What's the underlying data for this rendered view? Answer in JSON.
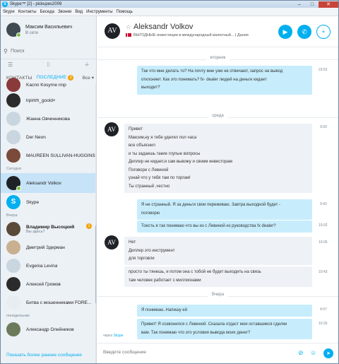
{
  "window": {
    "title": "Skype™ [2] - pickupes2009"
  },
  "menu": [
    "Skype",
    "Контакты",
    "Беседа",
    "Звонки",
    "Вид",
    "Инструменты",
    "Помощь"
  ],
  "me": {
    "name": "Максим Васильевич",
    "status": "В сети"
  },
  "search": {
    "placeholder": "Поиск"
  },
  "tabs": {
    "contacts": "КОНТАКТЫ",
    "recent": "ПОСЛЕДНИЕ",
    "recent_badge": "2",
    "filter": "Все"
  },
  "contacts": [
    {
      "name": "Kacnn Kosyrne nnp",
      "color": "#8b3a3a"
    },
    {
      "name": "lrpirtrh_goold+",
      "color": "#2b2b2b"
    },
    {
      "name": "Жанна Овчинникова",
      "color": "#c9d6e0"
    },
    {
      "name": "Der Neon",
      "color": "#c9d6e0"
    },
    {
      "name": "MAUREEN SULLIVAN-HUGGINS",
      "color": "#7a4a3a"
    }
  ],
  "section_today": "Сегодня",
  "selected_contact": {
    "name": "Aleksandr Volkov",
    "initials": "AV"
  },
  "skype_contact": {
    "name": "Skype"
  },
  "section_yesterday": "Вчера",
  "yesterday_contacts": [
    {
      "name": "Владимир Высоцкий",
      "sub": "Вы здесь?",
      "bold": true,
      "badge": "1",
      "color": "#5a4a3a"
    },
    {
      "name": "Дмитрий Здерман",
      "sub": "",
      "bold": false,
      "color": "#c9b090"
    },
    {
      "name": "Evgenia Levina",
      "sub": "",
      "bold": false,
      "color": "#c9d6e0"
    },
    {
      "name": "Алексей Громов",
      "sub": "",
      "bold": false,
      "color": "#2b2b2b"
    },
    {
      "name": "Битва с мошенниками FORE...",
      "sub": "",
      "bold": false,
      "color": "#e8edf1"
    }
  ],
  "section_earlier": "понедельник",
  "earlier_contacts": [
    {
      "name": "Александр Олейников",
      "color": "#6a7a5a"
    }
  ],
  "show_older": "Показать более ранние сообщения",
  "header": {
    "name": "Aleksandr Volkov",
    "initials": "AV",
    "mood": "ВЫГОДНЫЕ инвестиции в международный валютный...",
    "mood_suffix": "Дания"
  },
  "days": {
    "tuesday": "вторник",
    "wednesday": "среда",
    "yesterday": "Вчера"
  },
  "messages": [
    {
      "dir": "out",
      "lines": [
        "Так что мне делать то? На почту мне уже не отвечают, запрос на вывод",
        "отклоняет. Как это понимать? fx- dealer людей на деньги кидает",
        "выходит?"
      ],
      "time": "23:52"
    },
    {
      "dir": "in",
      "lines": [
        "Привет",
        "Максим,ну я тебе уделял пол часа",
        "все объяснил",
        "и ты задаешь такие глупые вопросы",
        "Диллер не кидает,я сам вывожу и своим инвесторам",
        "Поговори с Левиной",
        "узнай что у тебя там по торгам!",
        "Ты странный ,честно"
      ],
      "time": "9:09"
    },
    {
      "dir": "out",
      "lines": [
        "Я не странный. Я за деньги свои переживаю. Завтра выходной будет -",
        "поговорю"
      ],
      "time": "9:43"
    },
    {
      "dir": "out",
      "lines": [
        "Тоесть я так понимаю что вы из с Левиной из руководства fx dealer?"
      ],
      "time": "10:02"
    },
    {
      "dir": "in",
      "lines": [
        "Нет",
        "Диллер это инструмент",
        "для торговли"
      ],
      "time": "10:06"
    },
    {
      "dir": "in",
      "lines": [
        "просто ты тянешь, и потом она с тобой не будет выходить на связь",
        "там человек работает с миллионами"
      ],
      "time": "10:43"
    },
    {
      "dir": "out",
      "lines": [
        "Я понимаю..Напишу ей"
      ],
      "time": "4:07"
    },
    {
      "dir": "out",
      "lines": [
        "Привет! Я созвонился с Левиной. Сказала отдаст мои оставшиеся сделки",
        "вам. Так понимаю что это условия вывода моих денег?"
      ],
      "time": "10:26"
    }
  ],
  "via": {
    "prefix": "через",
    "service": "Skype"
  },
  "composer": {
    "placeholder": "Введите сообщение"
  }
}
